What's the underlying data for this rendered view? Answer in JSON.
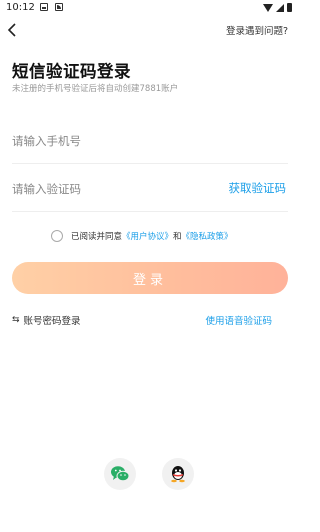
{
  "status_bar": {
    "time": "10:12"
  },
  "header": {
    "help_link": "登录遇到问题?"
  },
  "title": "短信验证码登录",
  "subtitle": "未注册的手机号验证后将自动创建7881账户",
  "phone_field": {
    "placeholder": "请输入手机号",
    "value": ""
  },
  "code_field": {
    "placeholder": "请输入验证码",
    "value": ""
  },
  "get_code_label": "获取验证码",
  "agreement": {
    "prefix": "已阅读并同意",
    "user_agreement": "《用户协议》",
    "and": "和",
    "privacy_policy": "《隐私政策》",
    "checked": false
  },
  "login_label": "登录",
  "password_login_label": "账号密码登录",
  "voice_code_label": "使用语音验证码",
  "colors": {
    "accent": "#1a9ee8",
    "button_gradient_start": "#ffd0a6",
    "button_gradient_end": "#ffb29a"
  },
  "social": [
    {
      "icon": "wechat-icon",
      "color": "#2aae67"
    },
    {
      "icon": "qq-icon",
      "color": "#111111"
    }
  ]
}
